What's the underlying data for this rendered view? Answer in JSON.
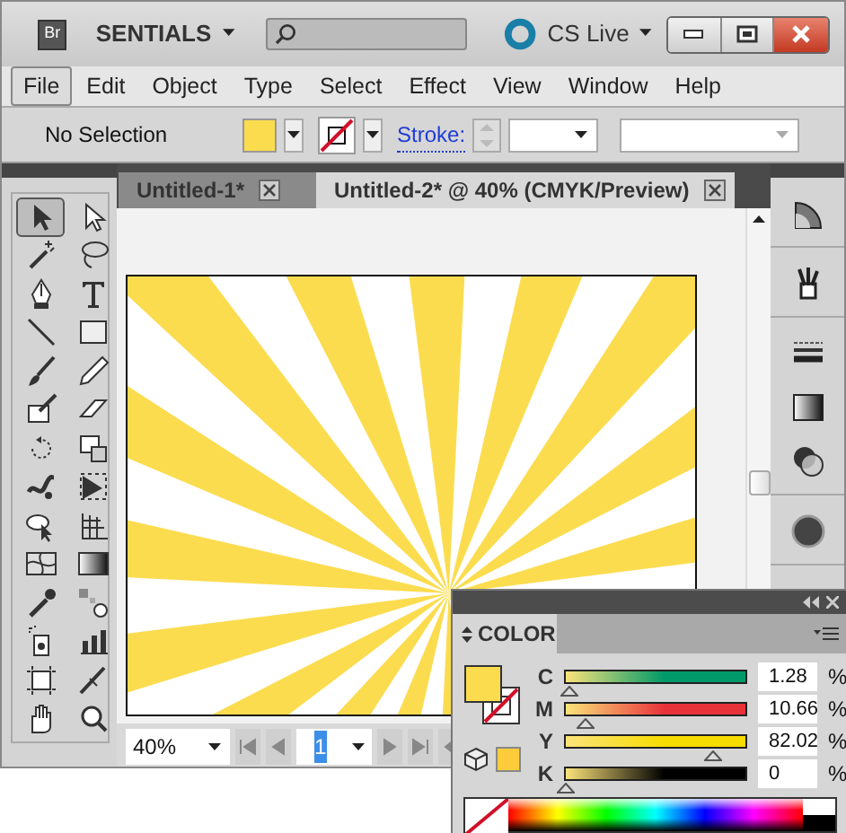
{
  "title_bar": {
    "bridge": "Br",
    "workspace": "SENTIALS",
    "cs_live": "CS Live"
  },
  "menu": [
    {
      "label": "File",
      "selected": true
    },
    {
      "label": "Edit",
      "selected": false
    },
    {
      "label": "Object",
      "selected": false
    },
    {
      "label": "Type",
      "selected": false
    },
    {
      "label": "Select",
      "selected": false
    },
    {
      "label": "Effect",
      "selected": false
    },
    {
      "label": "View",
      "selected": false
    },
    {
      "label": "Window",
      "selected": false
    },
    {
      "label": "Help",
      "selected": false
    }
  ],
  "control_bar": {
    "selection": "No Selection",
    "stroke_label": "Stroke:"
  },
  "tools": [
    {
      "kind": "selection",
      "selected": true
    },
    {
      "kind": "direct",
      "selected": false
    },
    {
      "kind": "wand",
      "selected": false
    },
    {
      "kind": "lasso",
      "selected": false
    },
    {
      "kind": "pen",
      "selected": false
    },
    {
      "kind": "type",
      "selected": false
    },
    {
      "kind": "line",
      "selected": false
    },
    {
      "kind": "rect",
      "selected": false
    },
    {
      "kind": "brush",
      "selected": false
    },
    {
      "kind": "pencil",
      "selected": false
    },
    {
      "kind": "blob",
      "selected": false
    },
    {
      "kind": "eraser",
      "selected": false
    },
    {
      "kind": "rotate",
      "selected": false
    },
    {
      "kind": "scale",
      "selected": false
    },
    {
      "kind": "warp",
      "selected": false
    },
    {
      "kind": "transform",
      "selected": false
    },
    {
      "kind": "builder",
      "selected": false
    },
    {
      "kind": "grid",
      "selected": false
    },
    {
      "kind": "mesh",
      "selected": false
    },
    {
      "kind": "gradient",
      "selected": false
    },
    {
      "kind": "eyedropper",
      "selected": false
    },
    {
      "kind": "blend",
      "selected": false
    },
    {
      "kind": "sprayer",
      "selected": false
    },
    {
      "kind": "graph",
      "selected": false
    },
    {
      "kind": "artboard",
      "selected": false
    },
    {
      "kind": "slice",
      "selected": false
    },
    {
      "kind": "hand",
      "selected": false
    },
    {
      "kind": "zoom",
      "selected": false
    }
  ],
  "tabs": [
    {
      "label": "Untitled-1*",
      "selected": false
    },
    {
      "label": "Untitled-2* @ 40% (CMYK/Preview)",
      "selected": true
    }
  ],
  "status_bar": {
    "zoom": "40%",
    "page": "1"
  },
  "color_panel": {
    "title": "COLOR",
    "channels": [
      {
        "name": "C",
        "value": "1.28",
        "unit": "%",
        "level": 0.02,
        "color": "#00996a"
      },
      {
        "name": "M",
        "value": "10.66",
        "unit": "%",
        "level": 0.11,
        "color": "#e8323a"
      },
      {
        "name": "Y",
        "value": "82.02",
        "unit": "%",
        "level": 0.82,
        "color": "#f7dc00"
      },
      {
        "name": "K",
        "value": "0",
        "unit": "%",
        "level": 0,
        "color": "#000000"
      }
    ]
  }
}
